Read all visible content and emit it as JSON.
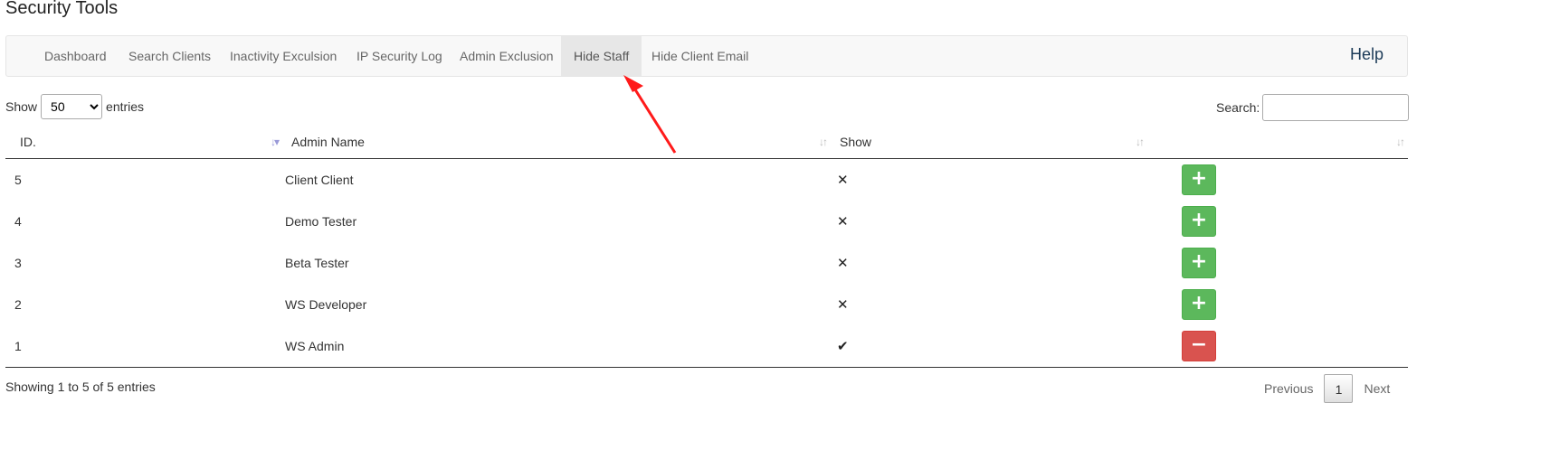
{
  "page": {
    "title": "Security Tools"
  },
  "nav": {
    "tabs": [
      {
        "label": "Dashboard"
      },
      {
        "label": "Search Clients"
      },
      {
        "label": "Inactivity Exculsion"
      },
      {
        "label": "IP Security Log"
      },
      {
        "label": "Admin Exclusion"
      },
      {
        "label": "Hide Staff",
        "active": true
      },
      {
        "label": "Hide Client Email"
      }
    ],
    "help_label": "Help"
  },
  "table_controls": {
    "show_label": "Show",
    "entries_value": "50",
    "entries_label": "entries",
    "search_label": "Search:",
    "search_value": ""
  },
  "table": {
    "columns": [
      "ID.",
      "Admin Name",
      "Show",
      ""
    ],
    "rows": [
      {
        "id": "5",
        "name": "Client Client",
        "show": "✕",
        "action": "+"
      },
      {
        "id": "4",
        "name": "Demo Tester",
        "show": "✕",
        "action": "+"
      },
      {
        "id": "3",
        "name": "Beta Tester",
        "show": "✕",
        "action": "+"
      },
      {
        "id": "2",
        "name": "WS Developer",
        "show": "✕",
        "action": "+"
      },
      {
        "id": "1",
        "name": "WS Admin",
        "show": "✔",
        "action": "−"
      }
    ]
  },
  "footer": {
    "info": "Showing 1 to 5 of 5 entries",
    "previous": "Previous",
    "page": "1",
    "next": "Next"
  },
  "icons": {
    "sort": "sort-icon",
    "sort_active": "sort-desc-icon",
    "annotation": "red-arrow-icon"
  },
  "colors": {
    "add": "#5cb85c",
    "remove": "#d9534f",
    "arrow": "#ff1a1a",
    "link": "#1b3a57"
  }
}
